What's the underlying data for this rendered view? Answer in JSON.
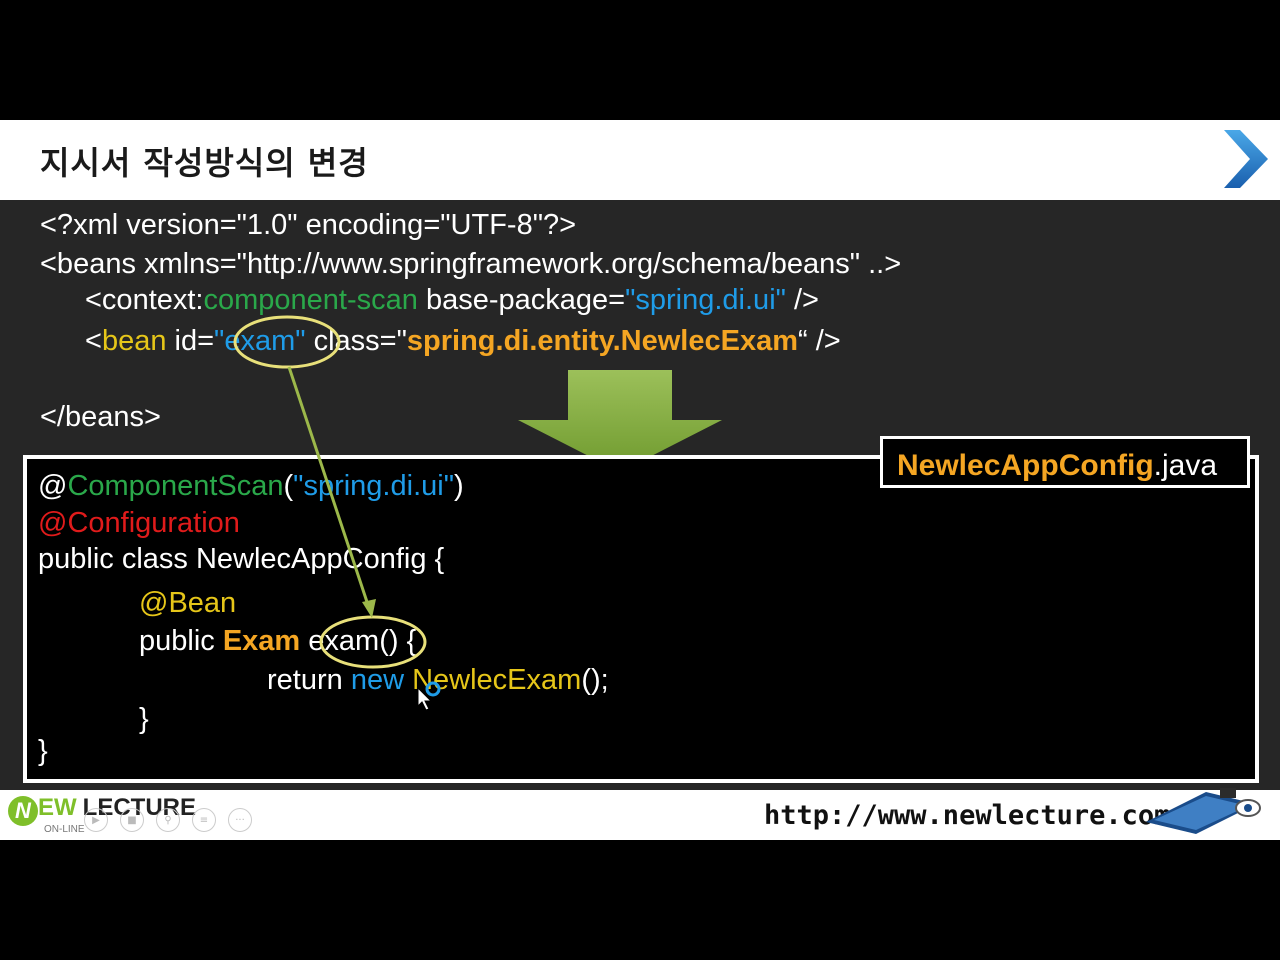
{
  "slide": {
    "title": "지시서 작성방식의 변경",
    "next_icon": "chevron-right-icon"
  },
  "xml": {
    "line1": "<?xml version=\"1.0\" encoding=\"UTF-8\"?>",
    "line2": "<beans xmlns=\"http://www.springframework.org/schema/beans\" ..>",
    "line3_prefix": "<context:",
    "line3_tag": "component-scan",
    "line3_attr": " base-package=",
    "line3_value": "\"spring.di.ui\"",
    "line3_suffix": " />",
    "line4_open": "<",
    "line4_tag": "bean",
    "line4_id_attr": " id=",
    "line4_id_value": "\"exam\"",
    "line4_class_attr": " class=\"",
    "line4_class_value": "spring.di.entity.NewlecExam",
    "line4_suffix": "“ />",
    "line5": "</beans>"
  },
  "java": {
    "file_name": "NewlecAppConfig",
    "file_ext": ".java",
    "l1_at": "@",
    "l1_annot": "ComponentScan",
    "l1_open": "(",
    "l1_value": "\"spring.di.ui\"",
    "l1_close": ")",
    "l2": "@Configuration",
    "l3": "public class NewlecAppConfig {",
    "l4": "@Bean",
    "l5_public": "public ",
    "l5_type": "Exam",
    "l5_method": " exam() {",
    "l6_return": "return ",
    "l6_new": "new ",
    "l6_class": "NewlecExam",
    "l6_end": "();",
    "l7": "}",
    "l8": "}"
  },
  "footer": {
    "logo_n": "N",
    "logo_ew": "EW",
    "logo_lecture": "LECTURE",
    "logo_sub": "ON-LINE",
    "url": "http://www.newlecture.com",
    "controls": [
      "play-icon",
      "stop-icon",
      "zoom-icon",
      "menu-icon",
      "more-icon"
    ]
  },
  "colors": {
    "green": "#2aa84a",
    "blue": "#1f9ce8",
    "orange": "#f5a623",
    "yellow": "#e6c619",
    "red": "#e01b1b",
    "arrow": "#8fb04a"
  }
}
